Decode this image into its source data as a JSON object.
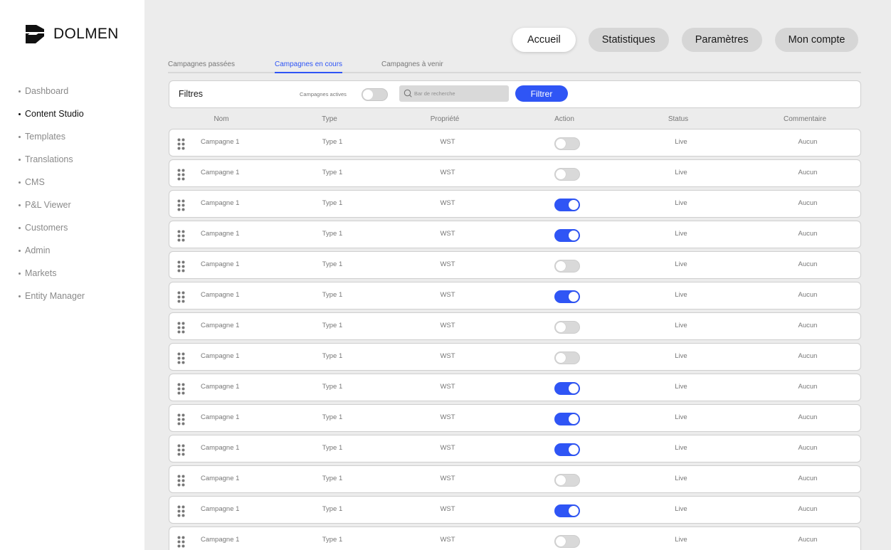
{
  "brand": {
    "name": "DOLMEN",
    "accent": "#2f55f5"
  },
  "sidebar": {
    "items": [
      {
        "label": "Dashboard",
        "active": false
      },
      {
        "label": "Content Studio",
        "active": true
      },
      {
        "label": "Templates",
        "active": false
      },
      {
        "label": "Translations",
        "active": false
      },
      {
        "label": "CMS",
        "active": false
      },
      {
        "label": "P&L Viewer",
        "active": false
      },
      {
        "label": "Customers",
        "active": false
      },
      {
        "label": "Admin",
        "active": false
      },
      {
        "label": "Markets",
        "active": false
      },
      {
        "label": "Entity Manager",
        "active": false
      }
    ]
  },
  "top_nav": {
    "items": [
      {
        "label": "Accueil",
        "active": true
      },
      {
        "label": "Statistiques",
        "active": false
      },
      {
        "label": "Paramètres",
        "active": false
      },
      {
        "label": "Mon compte",
        "active": false
      }
    ]
  },
  "tabs": [
    {
      "label": "Campagnes passées",
      "active": false
    },
    {
      "label": "Campagnes en cours",
      "active": true
    },
    {
      "label": "Campagnes à venir",
      "active": false
    }
  ],
  "filters": {
    "title": "Filtres",
    "active_label": "Campagnes actives",
    "active_on": false,
    "search_placeholder": "Bar de recherche",
    "button_label": "Filtrer"
  },
  "table": {
    "columns": [
      "Nom",
      "Type",
      "Propriété",
      "Action",
      "Status",
      "Commentaire"
    ],
    "rows": [
      {
        "name": "Campagne 1",
        "type": "Type 1",
        "property": "WST",
        "action": false,
        "status": "Live",
        "comment": "Aucun"
      },
      {
        "name": "Campagne 1",
        "type": "Type 1",
        "property": "WST",
        "action": false,
        "status": "Live",
        "comment": "Aucun"
      },
      {
        "name": "Campagne 1",
        "type": "Type 1",
        "property": "WST",
        "action": true,
        "status": "Live",
        "comment": "Aucun"
      },
      {
        "name": "Campagne 1",
        "type": "Type 1",
        "property": "WST",
        "action": true,
        "status": "Live",
        "comment": "Aucun"
      },
      {
        "name": "Campagne 1",
        "type": "Type 1",
        "property": "WST",
        "action": false,
        "status": "Live",
        "comment": "Aucun"
      },
      {
        "name": "Campagne 1",
        "type": "Type 1",
        "property": "WST",
        "action": true,
        "status": "Live",
        "comment": "Aucun"
      },
      {
        "name": "Campagne 1",
        "type": "Type 1",
        "property": "WST",
        "action": false,
        "status": "Live",
        "comment": "Aucun"
      },
      {
        "name": "Campagne 1",
        "type": "Type 1",
        "property": "WST",
        "action": false,
        "status": "Live",
        "comment": "Aucun"
      },
      {
        "name": "Campagne 1",
        "type": "Type 1",
        "property": "WST",
        "action": true,
        "status": "Live",
        "comment": "Aucun"
      },
      {
        "name": "Campagne 1",
        "type": "Type 1",
        "property": "WST",
        "action": true,
        "status": "Live",
        "comment": "Aucun"
      },
      {
        "name": "Campagne 1",
        "type": "Type 1",
        "property": "WST",
        "action": true,
        "status": "Live",
        "comment": "Aucun"
      },
      {
        "name": "Campagne 1",
        "type": "Type 1",
        "property": "WST",
        "action": false,
        "status": "Live",
        "comment": "Aucun"
      },
      {
        "name": "Campagne 1",
        "type": "Type 1",
        "property": "WST",
        "action": true,
        "status": "Live",
        "comment": "Aucun"
      },
      {
        "name": "Campagne 1",
        "type": "Type 1",
        "property": "WST",
        "action": false,
        "status": "Live",
        "comment": "Aucun"
      }
    ]
  }
}
